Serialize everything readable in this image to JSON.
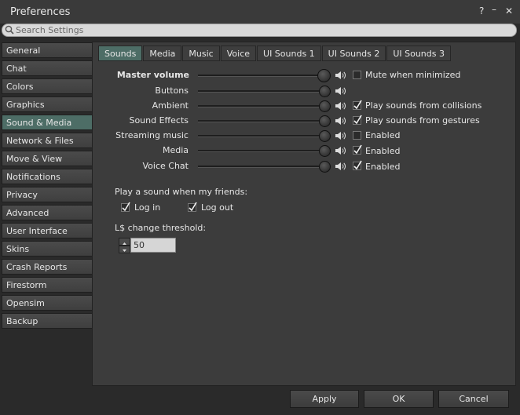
{
  "window": {
    "title": "Preferences",
    "help_label": "?",
    "minimize_label": "–",
    "close_label": "✕"
  },
  "search": {
    "placeholder": "Search Settings"
  },
  "sidebar": {
    "items": [
      {
        "label": "General"
      },
      {
        "label": "Chat"
      },
      {
        "label": "Colors"
      },
      {
        "label": "Graphics"
      },
      {
        "label": "Sound & Media",
        "active": true
      },
      {
        "label": "Network & Files"
      },
      {
        "label": "Move & View"
      },
      {
        "label": "Notifications"
      },
      {
        "label": "Privacy"
      },
      {
        "label": "Advanced"
      },
      {
        "label": "User Interface"
      },
      {
        "label": "Skins"
      },
      {
        "label": "Crash Reports"
      },
      {
        "label": "Firestorm"
      },
      {
        "label": "Opensim"
      },
      {
        "label": "Backup"
      }
    ]
  },
  "tabs": [
    {
      "label": "Sounds",
      "active": true
    },
    {
      "label": "Media"
    },
    {
      "label": "Music"
    },
    {
      "label": "Voice"
    },
    {
      "label": "UI Sounds 1"
    },
    {
      "label": "UI Sounds 2"
    },
    {
      "label": "UI Sounds 3"
    }
  ],
  "volumes": {
    "master": {
      "label": "Master volume",
      "option": "Mute when minimized",
      "checked": false
    },
    "rows": [
      {
        "label": "Buttons",
        "option": "",
        "checked": false
      },
      {
        "label": "Ambient",
        "option": "Play sounds from collisions",
        "checked": true
      },
      {
        "label": "Sound Effects",
        "option": "Play sounds from gestures",
        "checked": true
      },
      {
        "label": "Streaming music",
        "option": "Enabled",
        "checked": false
      },
      {
        "label": "Media",
        "option": "Enabled",
        "checked": true
      },
      {
        "label": "Voice Chat",
        "option": "Enabled",
        "checked": true
      }
    ]
  },
  "friends": {
    "heading": "Play a sound when my friends:",
    "login_label": "Log in",
    "login_checked": true,
    "logout_label": "Log out",
    "logout_checked": true
  },
  "threshold": {
    "label": "L$ change threshold:",
    "value": "50"
  },
  "footer": {
    "apply_label": "Apply",
    "ok_label": "OK",
    "cancel_label": "Cancel"
  }
}
